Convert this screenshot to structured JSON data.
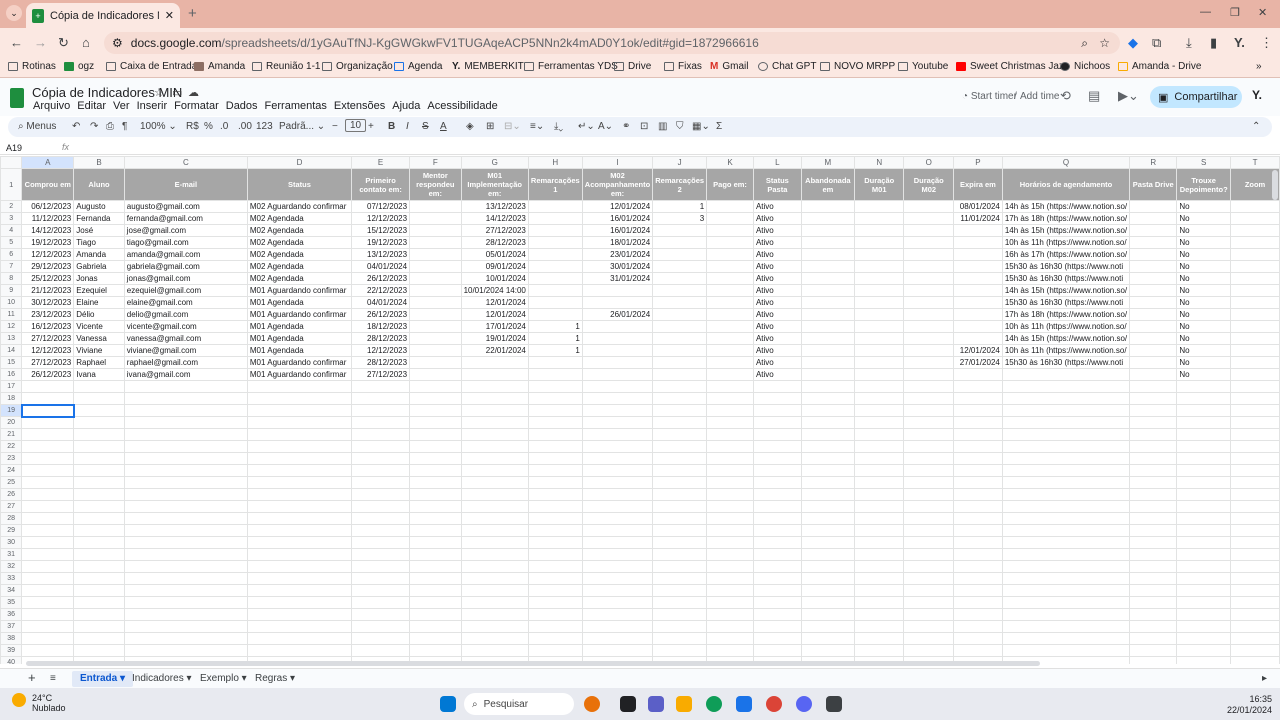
{
  "browser": {
    "tab_title": "Cópia de Indicadores MIN - Pla",
    "url_domain": "docs.google.com",
    "url_path": "/spreadsheets/d/1yGAuTfNJ-KgGWGkwFV1TUGAqeACP5NNn2k4mAD0Y1ok/edit#gid=1872966616",
    "profile": "Y.",
    "bookmarks": [
      "Rotinas",
      "ogz",
      "Caixa de Entrada",
      "Amanda",
      "Reunião 1-1",
      "Organização",
      "Agenda",
      "MEMBERKIT",
      "Ferramentas YDS",
      "Drive",
      "Fixas",
      "Gmail",
      "Chat GPT",
      "NOVO MRPP",
      "Youtube",
      "Sweet Christmas Jazz",
      "Nichoos",
      "Amanda - Drive"
    ]
  },
  "doc": {
    "title": "Cópia de Indicadores MIN",
    "menus": [
      "Arquivo",
      "Editar",
      "Ver",
      "Inserir",
      "Formatar",
      "Dados",
      "Ferramentas",
      "Extensões",
      "Ajuda",
      "Acessibilidade"
    ],
    "start_timer": "Start timer",
    "add_time": "Add time",
    "share": "Compartilhar"
  },
  "toolbar": {
    "menus": "Menus",
    "zoom": "100%",
    "currency": "R$",
    "percent": "%",
    "dec_less": ".0",
    "dec_more": ".00",
    "num_fmt": "123",
    "font": "Padrã...",
    "font_size": "10"
  },
  "formula_bar": {
    "cell_ref": "A19",
    "fx": "fx"
  },
  "grid": {
    "columns": [
      "A",
      "B",
      "C",
      "D",
      "E",
      "F",
      "G",
      "H",
      "I",
      "J",
      "K",
      "L",
      "M",
      "N",
      "O",
      "P",
      "Q",
      "R",
      "S",
      "T"
    ],
    "headers": [
      "Comprou em",
      "Aluno",
      "E-mail",
      "Status",
      "Primeiro contato em:",
      "Mentor respondeu em:",
      "M01 Implementação em:",
      "Remarcações 1",
      "M02 Acompanhamento em:",
      "Remarcações 2",
      "Pago em:",
      "Status Pasta",
      "Abandonada em",
      "Duração M01",
      "Duração M02",
      "Expira em",
      "Horários de agendamento",
      "Pasta Drive",
      "Trouxe Depoimento?",
      "Zoom"
    ],
    "rows": [
      [
        "06/12/2023",
        "Augusto",
        "augusto@gmail.com",
        "M02 Aguardando confirmar",
        "07/12/2023",
        "",
        "13/12/2023",
        "",
        "12/01/2024",
        "1",
        "",
        "Ativo",
        "",
        "",
        "",
        "08/01/2024",
        "14h às 15h (https://www.notion.so/",
        "",
        "No",
        ""
      ],
      [
        "11/12/2023",
        "Fernanda",
        "fernanda@gmail.com",
        "M02 Agendada",
        "12/12/2023",
        "",
        "14/12/2023",
        "",
        "16/01/2024",
        "3",
        "",
        "Ativo",
        "",
        "",
        "",
        "11/01/2024",
        "17h às 18h (https://www.notion.so/",
        "",
        "No",
        ""
      ],
      [
        "14/12/2023",
        "José",
        "jose@gmail.com",
        "M02 Agendada",
        "15/12/2023",
        "",
        "27/12/2023",
        "",
        "16/01/2024",
        "",
        "",
        "Ativo",
        "",
        "",
        "",
        "",
        "14h às 15h (https://www.notion.so/",
        "",
        "No",
        ""
      ],
      [
        "19/12/2023",
        "Tiago",
        "tiago@gmail.com",
        "M02 Agendada",
        "19/12/2023",
        "",
        "28/12/2023",
        "",
        "18/01/2024",
        "",
        "",
        "Ativo",
        "",
        "",
        "",
        "",
        "10h às 11h (https://www.notion.so/",
        "",
        "No",
        ""
      ],
      [
        "12/12/2023",
        "Amanda",
        "amanda@gmail.com",
        "M02 Agendada",
        "13/12/2023",
        "",
        "05/01/2024",
        "",
        "23/01/2024",
        "",
        "",
        "Ativo",
        "",
        "",
        "",
        "",
        "16h às 17h (https://www.notion.so/",
        "",
        "No",
        ""
      ],
      [
        "29/12/2023",
        "Gabriela",
        "gabriela@gmail.com",
        "M02 Agendada",
        "04/01/2024",
        "",
        "09/01/2024",
        "",
        "30/01/2024",
        "",
        "",
        "Ativo",
        "",
        "",
        "",
        "",
        "15h30 às 16h30 (https://www.noti",
        "",
        "No",
        ""
      ],
      [
        "25/12/2023",
        "Jonas",
        "jonas@gmail.com",
        "M02 Agendada",
        "26/12/2023",
        "",
        "10/01/2024",
        "",
        "31/01/2024",
        "",
        "",
        "Ativo",
        "",
        "",
        "",
        "",
        "15h30 às 16h30 (https://www.noti",
        "",
        "No",
        ""
      ],
      [
        "21/12/2023",
        "Ezequiel",
        "ezequiel@gmail.com",
        "M01 Aguardando confirmar",
        "22/12/2023",
        "",
        "10/01/2024 14:00",
        "",
        "",
        "",
        "",
        "Ativo",
        "",
        "",
        "",
        "",
        "14h às 15h (https://www.notion.so/",
        "",
        "No",
        ""
      ],
      [
        "30/12/2023",
        "Elaine",
        "elaine@gmail.com",
        "M01 Agendada",
        "04/01/2024",
        "",
        "12/01/2024",
        "",
        "",
        "",
        "",
        "Ativo",
        "",
        "",
        "",
        "",
        "15h30 às 16h30 (https://www.noti",
        "",
        "No",
        ""
      ],
      [
        "23/12/2023",
        "Délio",
        "delio@gmail.com",
        "M01 Aguardando confirmar",
        "26/12/2023",
        "",
        "12/01/2024",
        "",
        "26/01/2024",
        "",
        "",
        "Ativo",
        "",
        "",
        "",
        "",
        "17h às 18h (https://www.notion.so/",
        "",
        "No",
        ""
      ],
      [
        "16/12/2023",
        "Vicente",
        "vicente@gmail.com",
        "M01 Agendada",
        "18/12/2023",
        "",
        "17/01/2024",
        "1",
        "",
        "",
        "",
        "Ativo",
        "",
        "",
        "",
        "",
        "10h às 11h (https://www.notion.so/",
        "",
        "No",
        ""
      ],
      [
        "27/12/2023",
        "Vanessa",
        "vanessa@gmail.com",
        "M01 Agendada",
        "28/12/2023",
        "",
        "19/01/2024",
        "1",
        "",
        "",
        "",
        "Ativo",
        "",
        "",
        "",
        "",
        "14h às 15h (https://www.notion.so/",
        "",
        "No",
        ""
      ],
      [
        "12/12/2023",
        "Viviane",
        "viviane@gmail.com",
        "M01 Agendada",
        "12/12/2023",
        "",
        "22/01/2024",
        "1",
        "",
        "",
        "",
        "Ativo",
        "",
        "",
        "",
        "12/01/2024",
        "10h às 11h (https://www.notion.so/",
        "",
        "No",
        ""
      ],
      [
        "27/12/2023",
        "Raphael",
        "raphael@gmail.com",
        "M01 Aguardando confirmar",
        "28/12/2023",
        "",
        "",
        "",
        "",
        "",
        "",
        "Ativo",
        "",
        "",
        "",
        "27/01/2024",
        "15h30 às 16h30 (https://www.noti",
        "",
        "No",
        ""
      ],
      [
        "26/12/2023",
        "Ivana",
        "ivana@gmail.com",
        "M01 Aguardando confirmar",
        "27/12/2023",
        "",
        "",
        "",
        "",
        "",
        "",
        "Ativo",
        "",
        "",
        "",
        "",
        "",
        "",
        "No",
        ""
      ]
    ]
  },
  "sheets": [
    "Entrada",
    "Indicadores",
    "Exemplo",
    "Regras"
  ],
  "taskbar": {
    "temp": "24°C",
    "weather": "Nublado",
    "search": "Pesquisar",
    "time": "16:35",
    "date": "22/01/2024"
  }
}
